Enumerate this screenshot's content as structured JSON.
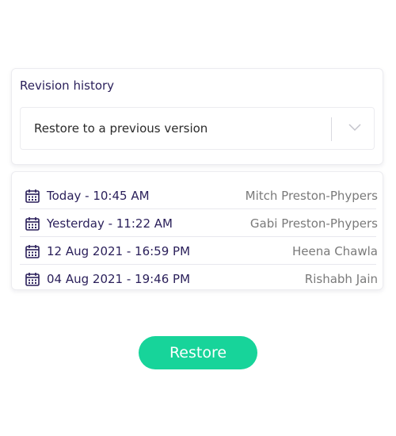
{
  "panel": {
    "title": "Revision history",
    "select": {
      "value": "Restore to a previous version",
      "chevron_icon": "chevron-down-icon"
    }
  },
  "revisions": [
    {
      "date": "Today - 10:45 AM",
      "author": "Mitch Preston-Phypers",
      "icon": "calendar-icon"
    },
    {
      "date": "Yesterday - 11:22 AM",
      "author": "Gabi Preston-Phypers",
      "icon": "calendar-icon"
    },
    {
      "date": "12 Aug 2021 - 16:59 PM",
      "author": "Heena Chawla",
      "icon": "calendar-icon"
    },
    {
      "date": "04 Aug 2021 - 19:46 PM",
      "author": "Rishabh Jain",
      "icon": "calendar-icon"
    }
  ],
  "actions": {
    "restore_label": "Restore"
  },
  "colors": {
    "title_text": "#2a1f5a",
    "author_text": "#7a7a7a",
    "restore_button": "#17d49a",
    "border": "#ececf0"
  }
}
